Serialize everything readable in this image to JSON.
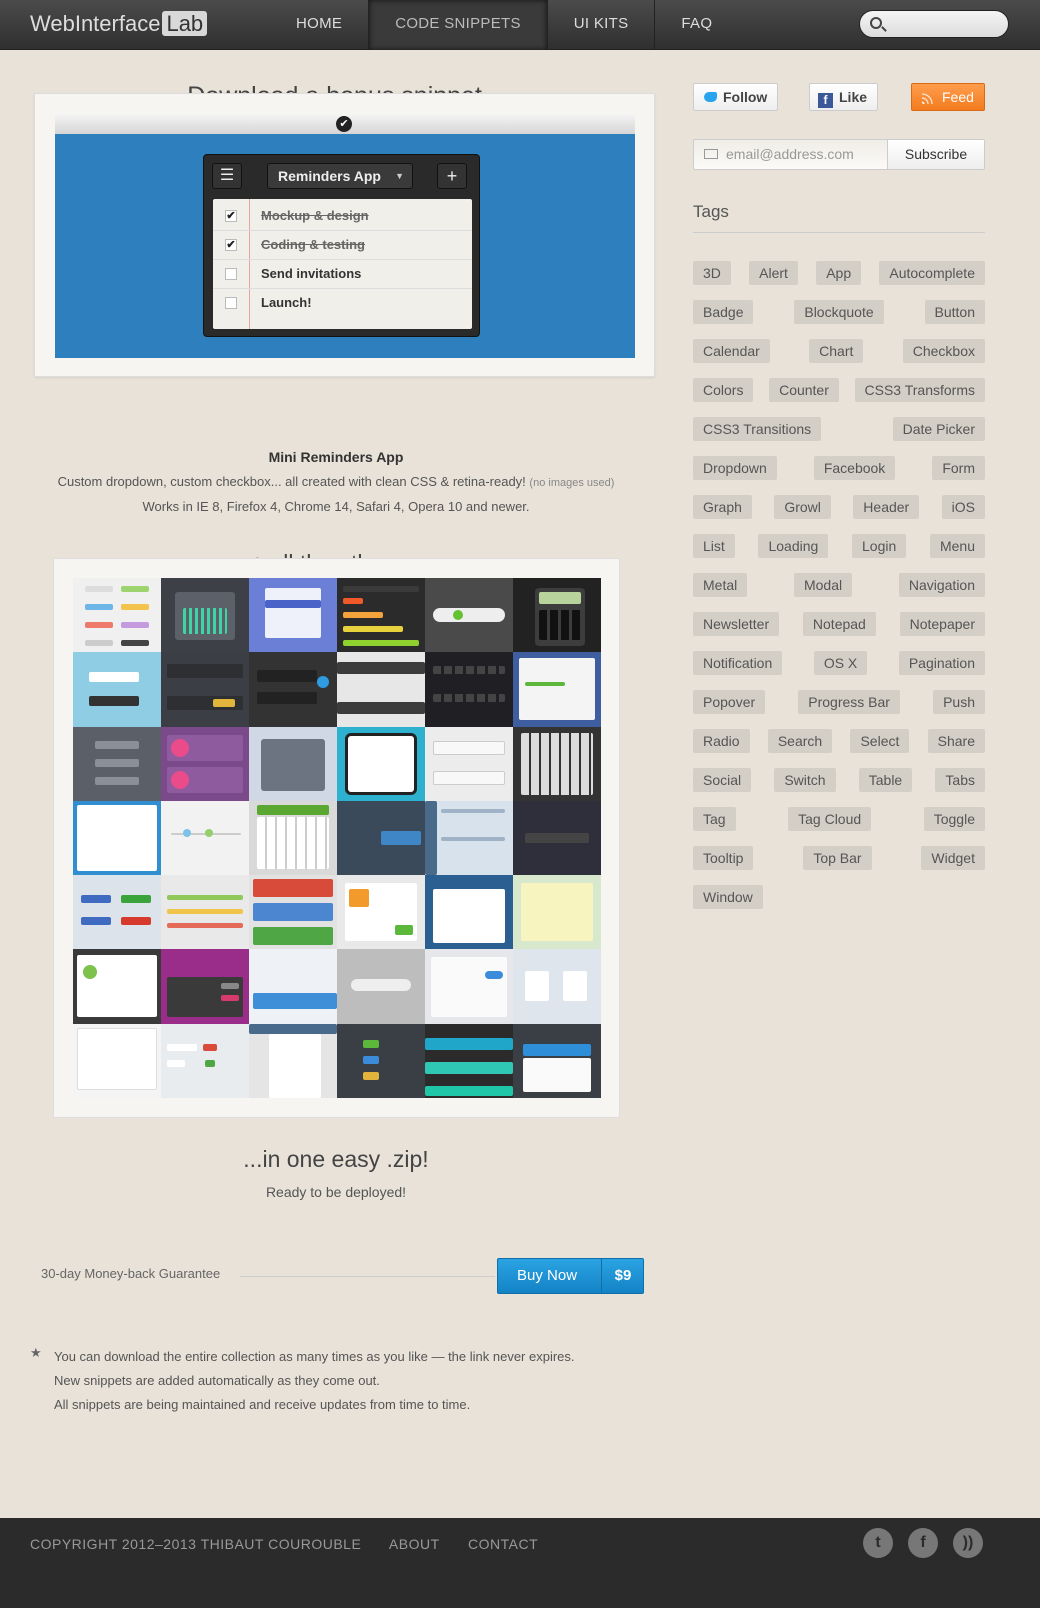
{
  "header": {
    "logo_main": "WebInterface",
    "logo_badge": "Lab",
    "nav": [
      {
        "label": "HOME"
      },
      {
        "label": "CODE SNIPPETS"
      },
      {
        "label": "UI KITS"
      },
      {
        "label": "FAQ"
      }
    ]
  },
  "main": {
    "title": "Download a bonus snippet...",
    "reminders": {
      "title": "Reminders App",
      "items": [
        {
          "label": "Mockup & design",
          "done": true
        },
        {
          "label": "Coding & testing",
          "done": true
        },
        {
          "label": "Send invitations",
          "done": false
        },
        {
          "label": "Launch!",
          "done": false
        }
      ]
    },
    "snippet_name": "Mini Reminders App",
    "snippet_desc": "Custom dropdown, custom checkbox... all created with clean CSS & retina-ready!",
    "snippet_note": "(no images used)",
    "snippet_compat": "Works in IE 8, Firefox 4, Chrome 14, Safari 4, Opera 10 and newer.",
    "others_title": "+ all the others...",
    "zip_title": "...in one easy .zip!",
    "zip_sub": "Ready to be deployed!",
    "guarantee": "30-day Money-back Guarantee",
    "buy_label": "Buy Now",
    "buy_price": "$9",
    "notes": [
      "You can download the entire collection as many times as you like — the link never expires.",
      "New snippets are added automatically as they come out.",
      "All snippets are being maintained and receive updates from time to time."
    ]
  },
  "sidebar": {
    "follow": "Follow",
    "like": "Like",
    "feed": "Feed",
    "email_placeholder": "email@address.com",
    "subscribe": "Subscribe",
    "tags_title": "Tags",
    "tag_rows": [
      [
        "3D",
        "Alert",
        "App",
        "Autocomplete"
      ],
      [
        "Badge",
        "Blockquote",
        "Button"
      ],
      [
        "Calendar",
        "Chart",
        "Checkbox"
      ],
      [
        "Colors",
        "Counter",
        "CSS3 Transforms"
      ],
      [
        "CSS3 Transitions",
        "Date Picker"
      ],
      [
        "Dropdown",
        "Facebook",
        "Form"
      ],
      [
        "Graph",
        "Growl",
        "Header",
        "iOS"
      ],
      [
        "List",
        "Loading",
        "Login",
        "Menu"
      ],
      [
        "Metal",
        "Modal",
        "Navigation"
      ],
      [
        "Newsletter",
        "Notepad",
        "Notepaper"
      ],
      [
        "Notification",
        "OS X",
        "Pagination"
      ],
      [
        "Popover",
        "Progress Bar",
        "Push"
      ],
      [
        "Radio",
        "Search",
        "Select",
        "Share"
      ],
      [
        "Social",
        "Switch",
        "Table",
        "Tabs"
      ],
      [
        "Tag",
        "Tag Cloud",
        "Toggle"
      ],
      [
        "Tooltip",
        "Top Bar",
        "Widget"
      ],
      [
        "Window"
      ]
    ]
  },
  "footer": {
    "copyright": "COPYRIGHT 2012–2013 THIBAUT COUROUBLE",
    "about": "ABOUT",
    "contact": "CONTACT"
  },
  "colors": {
    "accent_blue": "#1e93d6",
    "feed_orange": "#f38a2f",
    "page_bg": "#e8e2d8"
  }
}
